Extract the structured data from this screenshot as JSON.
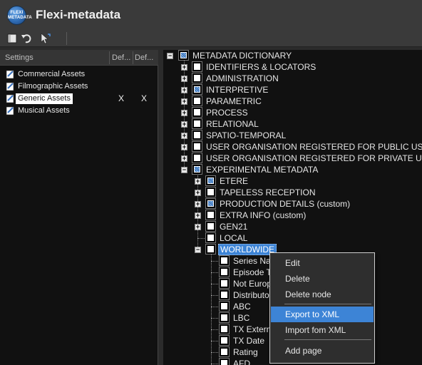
{
  "app": {
    "title": "Flexi-metadata",
    "logo_text": "FLEXI METADATA"
  },
  "toolbar": {
    "buttons": [
      {
        "name": "new-icon"
      },
      {
        "name": "undo-icon"
      },
      {
        "name": "pointer-icon"
      }
    ]
  },
  "settings": {
    "columns": [
      "Settings",
      "Def...",
      "Def..."
    ],
    "items": [
      {
        "label": "Commercial Assets",
        "col2": "",
        "col3": ""
      },
      {
        "label": "Filmographic Assets",
        "col2": "",
        "col3": ""
      },
      {
        "label": "Generic Assets",
        "col2": "X",
        "col3": "X",
        "selected": true
      },
      {
        "label": "Musical Assets",
        "col2": "",
        "col3": ""
      }
    ]
  },
  "tree": {
    "root": "METADATA DICTIONARY",
    "level1": [
      "IDENTIFIERS & LOCATORS",
      "ADMINISTRATION",
      "INTERPRETIVE",
      "PARAMETRIC",
      "PROCESS",
      "RELATIONAL",
      "SPATIO-TEMPORAL",
      "USER ORGANISATION REGISTERED FOR PUBLIC USE",
      "USER ORGANISATION REGISTERED FOR PRIVATE USE",
      "EXPERIMENTAL METADATA"
    ],
    "level2": [
      "ETERE",
      "TAPELESS RECEPTION",
      "PRODUCTION DETAILS (custom)",
      "EXTRA INFO (custom)",
      "GEN21",
      "LOCAL",
      "WORLDWIDE"
    ],
    "level3": [
      "Series Nam",
      "Episode Ti",
      "Not Europ",
      "Distributor",
      "ABC",
      "LBC",
      "TX Externa",
      "TX Date",
      "Rating",
      "AFD"
    ]
  },
  "context_menu": {
    "items": [
      "Edit",
      "Delete",
      "Delete node",
      "Export to XML",
      "Import fom XML",
      "Add page"
    ],
    "active": "Export to XML"
  }
}
